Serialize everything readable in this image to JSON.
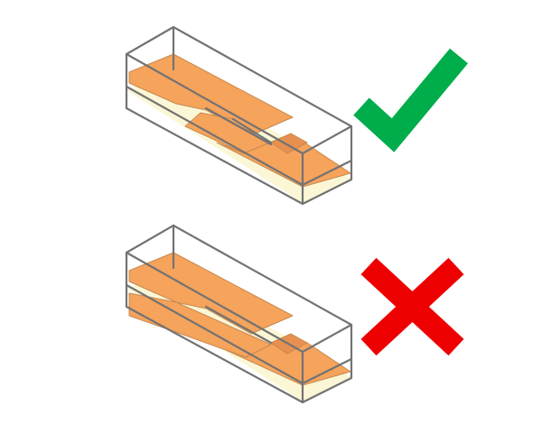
{
  "colors": {
    "background": "#ffffff",
    "box_edge": "#737373",
    "box_floor": "#fbf7d6",
    "slab_fill": "#f6a35c",
    "slab_edge": "#c78a4e",
    "check": "#00ad4b",
    "cross": "#ee0000"
  },
  "panels": [
    {
      "variant": "correct",
      "mark_icon": "check-icon"
    },
    {
      "variant": "incorrect",
      "mark_icon": "cross-icon"
    }
  ]
}
